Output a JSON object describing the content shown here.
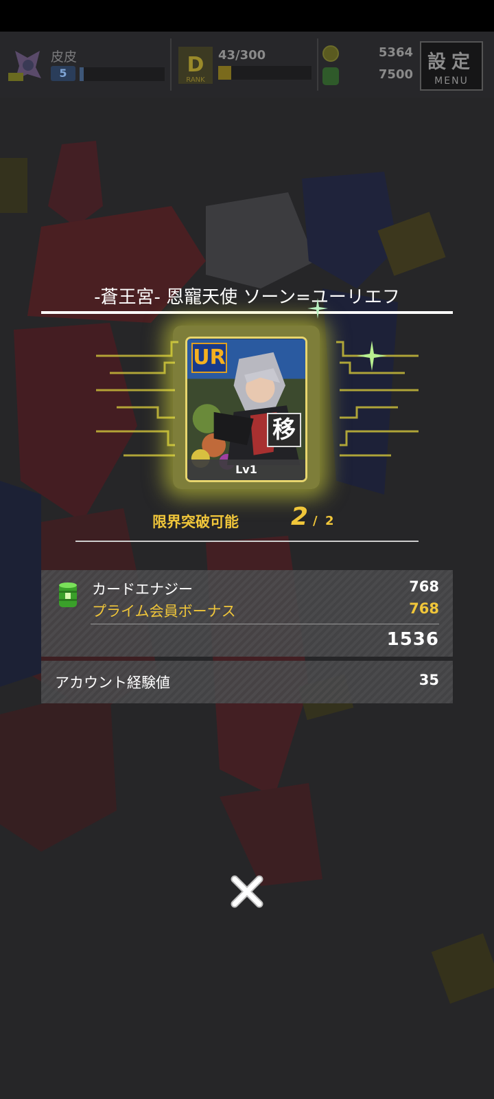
{
  "header": {
    "player_name": "皮皮",
    "player_level": "5",
    "player_level_progress": 0.05,
    "rank_letter": "D",
    "rank_label": "RANK",
    "rank_progress_text": "43/300",
    "rank_progress": 0.14,
    "coins": "5364",
    "energy": "7500",
    "menu_kanji": "設定",
    "menu_label": "MENU"
  },
  "card": {
    "name": "-蒼王宮- 恩寵天使 ソーン=ユーリエフ",
    "rarity": "UR",
    "type_badge": "移",
    "level": "Lv1"
  },
  "limit_break": {
    "label": "限界突破可能",
    "current": "2",
    "separator": "/",
    "max": "2"
  },
  "rewards": {
    "card_energy_label": "カードエナジー",
    "card_energy_value": "768",
    "prime_bonus_label": "プライム会員ボーナス",
    "prime_bonus_value": "768",
    "total_value": "1536",
    "account_exp_label": "アカウント経験値",
    "account_exp_value": "35"
  },
  "colors": {
    "gold": "#f0c63a",
    "glow": "#e8ea50",
    "panel": "#464648"
  },
  "icons": [
    "close-icon",
    "card-energy-icon",
    "coin-icon",
    "energy-icon",
    "rank-icon",
    "avatar-icon"
  ]
}
